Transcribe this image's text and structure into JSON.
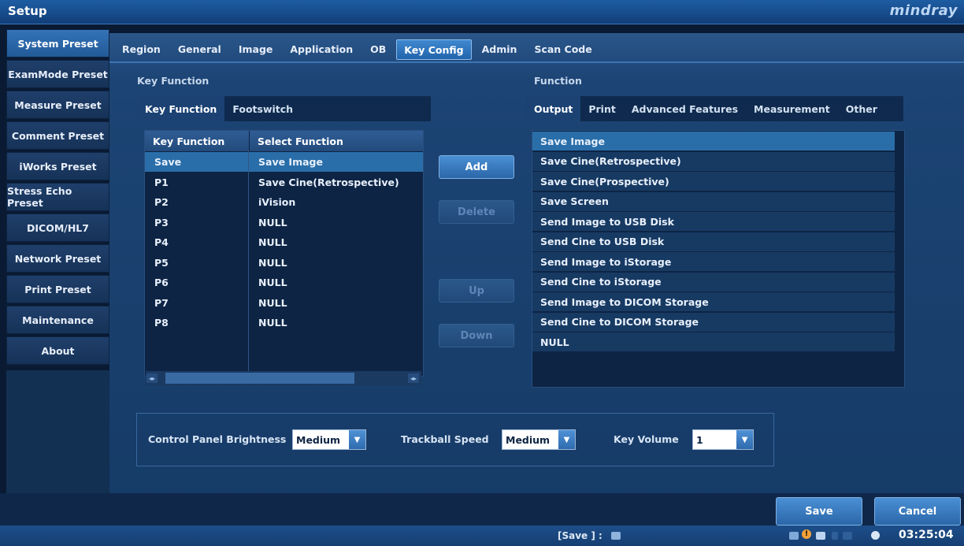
{
  "window": {
    "title": "Setup",
    "brand": "mindray"
  },
  "left_menu": [
    {
      "label": "System Preset",
      "active": true
    },
    {
      "label": "ExamMode Preset"
    },
    {
      "label": "Measure Preset"
    },
    {
      "label": "Comment Preset"
    },
    {
      "label": "iWorks Preset"
    },
    {
      "label": "Stress Echo Preset"
    },
    {
      "label": "DICOM/HL7"
    },
    {
      "label": "Network Preset"
    },
    {
      "label": "Print Preset"
    },
    {
      "label": "Maintenance"
    },
    {
      "label": "About"
    }
  ],
  "tabs": [
    {
      "label": "Region"
    },
    {
      "label": "General"
    },
    {
      "label": "Image"
    },
    {
      "label": "Application"
    },
    {
      "label": "OB"
    },
    {
      "label": "Key Config",
      "active": true
    },
    {
      "label": "Admin"
    },
    {
      "label": "Scan Code"
    }
  ],
  "key_function": {
    "section_title": "Key Function",
    "subtabs": [
      {
        "label": "Key Function",
        "active": true
      },
      {
        "label": "Footswitch"
      }
    ],
    "table": {
      "headers": [
        "Key Function",
        "Select Function"
      ],
      "rows": [
        [
          "Save",
          "Save Image"
        ],
        [
          "P1",
          "Save Cine(Retrospective)"
        ],
        [
          "P2",
          "iVision"
        ],
        [
          "P3",
          "NULL"
        ],
        [
          "P4",
          "NULL"
        ],
        [
          "P5",
          "NULL"
        ],
        [
          "P6",
          "NULL"
        ],
        [
          "P7",
          "NULL"
        ],
        [
          "P8",
          "NULL"
        ]
      ],
      "selected_row": 0
    }
  },
  "actions": {
    "add": "Add",
    "delete": "Delete",
    "up": "Up",
    "down": "Down"
  },
  "function": {
    "section_title": "Function",
    "subtabs": [
      {
        "label": "Output",
        "active": true
      },
      {
        "label": "Print"
      },
      {
        "label": "Advanced Features"
      },
      {
        "label": "Measurement"
      },
      {
        "label": "Other"
      }
    ],
    "items": [
      "Save Image",
      "Save Cine(Retrospective)",
      "Save Cine(Prospective)",
      "Save Screen",
      "Send Image to USB Disk",
      "Send Cine to USB Disk",
      "Send Image to iStorage",
      "Send Cine to iStorage",
      "Send Image to DICOM Storage",
      "Send Cine to DICOM Storage",
      "NULL"
    ],
    "selected_item": 0
  },
  "settings": {
    "brightness_label": "Control Panel Brightness",
    "brightness_value": "Medium",
    "trackball_label": "Trackball Speed",
    "trackball_value": "Medium",
    "volume_label": "Key Volume",
    "volume_value": "1"
  },
  "footer": {
    "save": "Save",
    "cancel": "Cancel"
  },
  "status": {
    "save_hint": "[Save ] :",
    "time": "03:25:04"
  },
  "colors": {
    "accent": "#2a6ea9",
    "panel": "#1c4474",
    "background": "#0a1a33"
  }
}
